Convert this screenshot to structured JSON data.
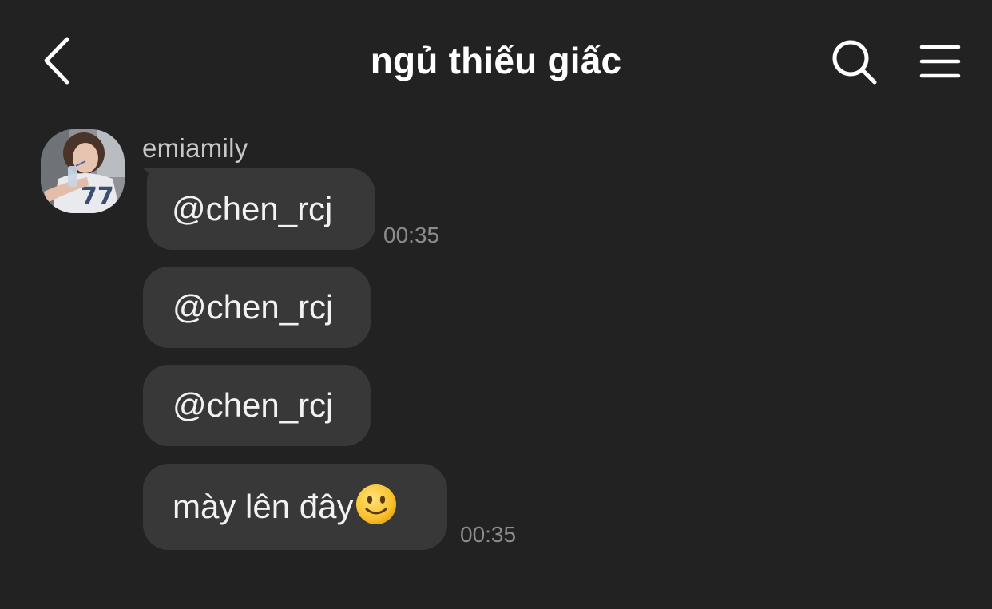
{
  "header": {
    "title": "ngủ thiếu giấc",
    "back_icon": "chevron-left-icon",
    "search_icon": "search-icon",
    "menu_icon": "hamburger-menu-icon"
  },
  "sender": {
    "username": "emiamily",
    "avatar": "user-avatar"
  },
  "messages": [
    {
      "text": "@chen_rcj",
      "time": "00:35"
    },
    {
      "text": "@chen_rcj"
    },
    {
      "text": "@chen_rcj"
    },
    {
      "text": "mày lên đây",
      "emoji": "slightly-smiling-face",
      "time": "00:35"
    }
  ],
  "colors": {
    "background": "#222222",
    "bubble": "#383838",
    "timestamp": "#8c8c8c"
  }
}
